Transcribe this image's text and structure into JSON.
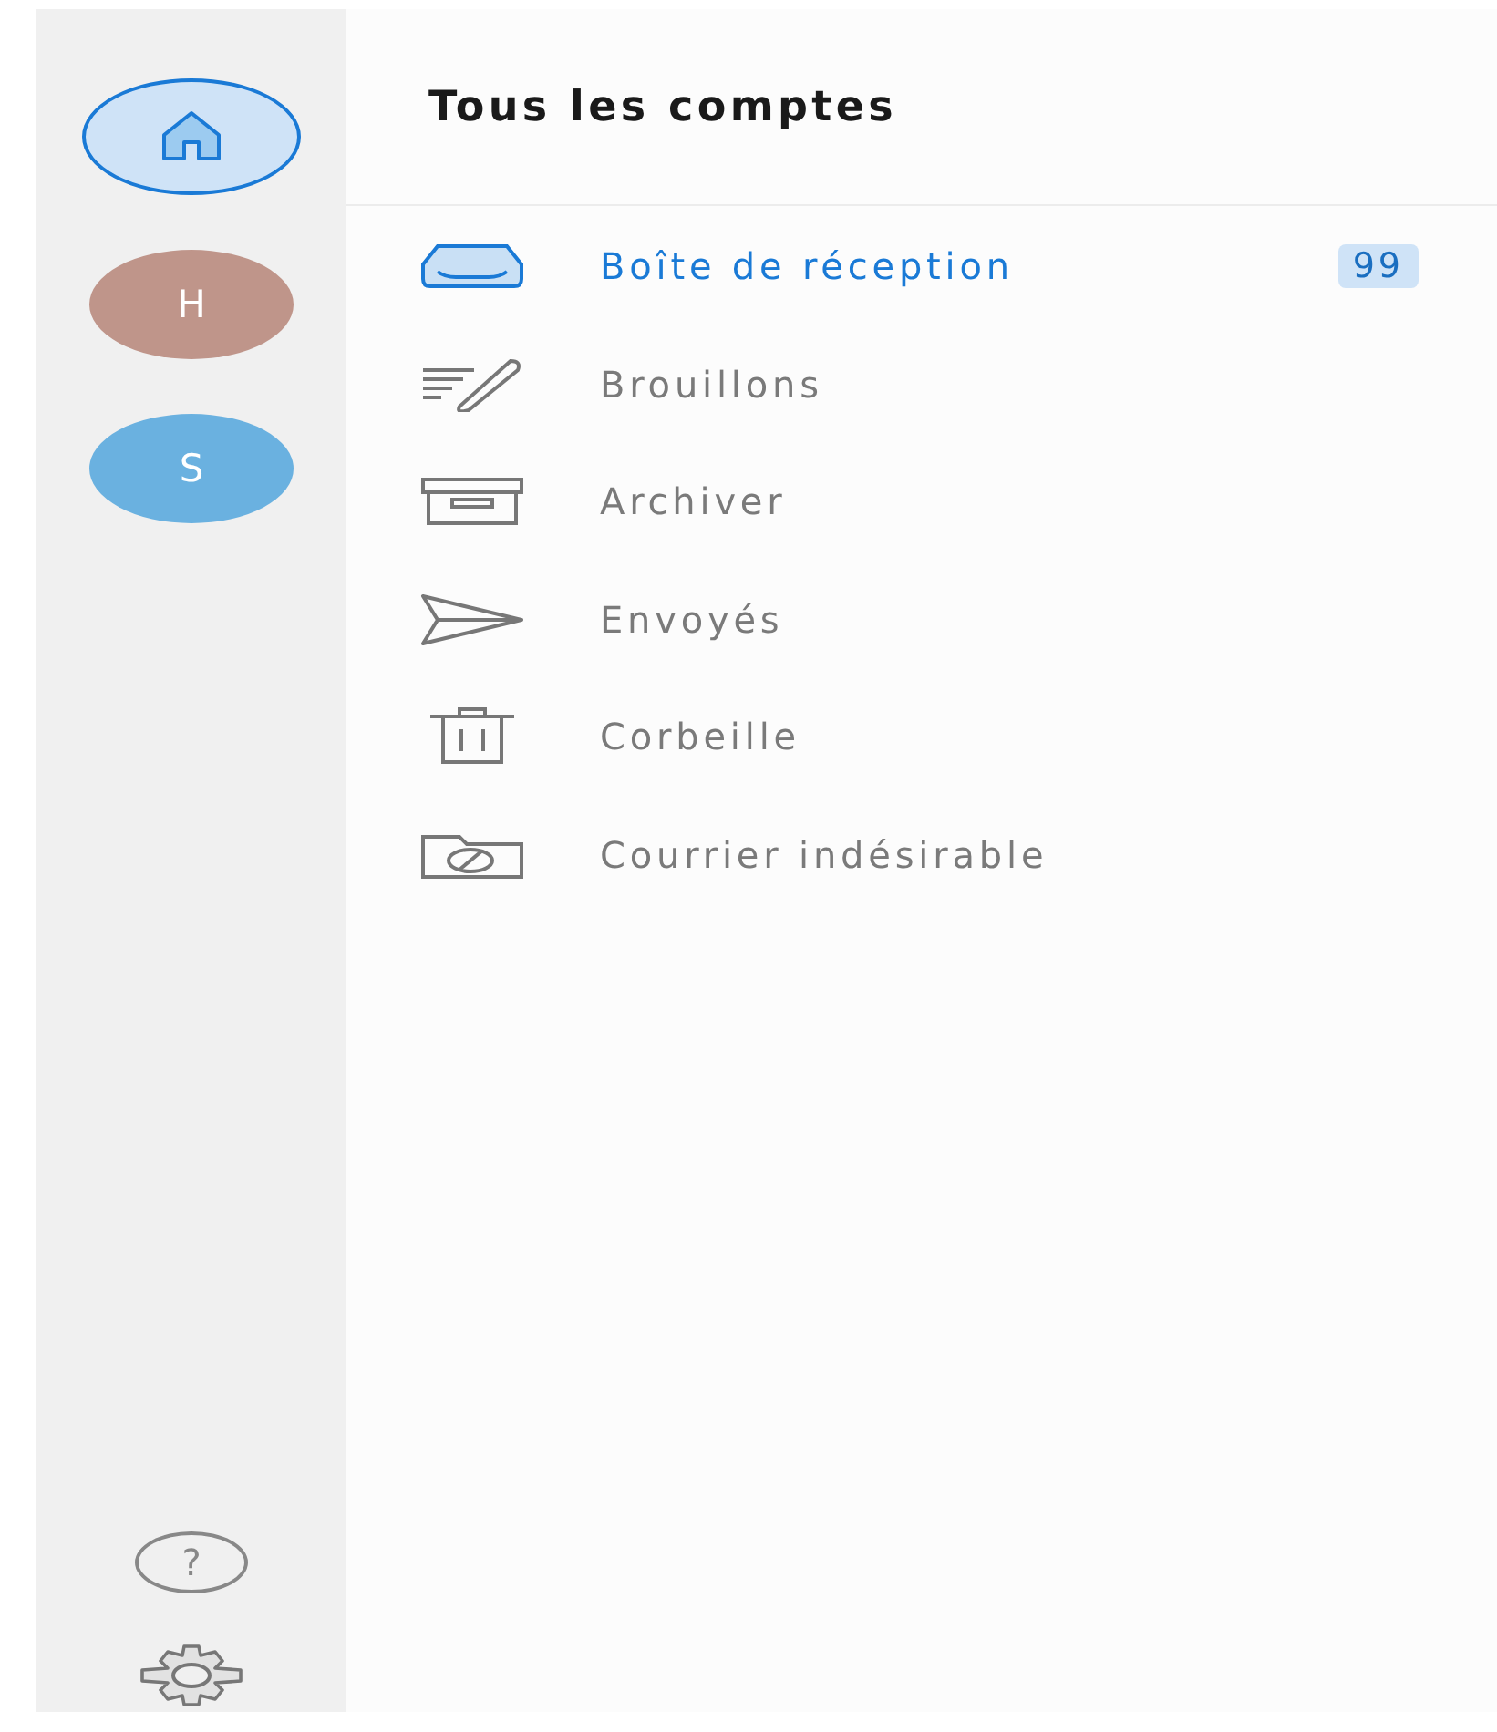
{
  "sidebar": {
    "accounts": [
      {
        "kind": "home",
        "selected": true
      },
      {
        "kind": "avatar",
        "label": "H",
        "color": "#bf958a",
        "selected": false
      },
      {
        "kind": "avatar",
        "label": "S",
        "color": "#6ab1e0",
        "selected": false
      }
    ],
    "help_button": "?"
  },
  "header": {
    "title": "Tous les comptes"
  },
  "folders": [
    {
      "kind": "inbox",
      "label": "Boîte de réception",
      "badge": "99",
      "selected": true
    },
    {
      "kind": "drafts",
      "label": "Brouillons",
      "selected": false
    },
    {
      "kind": "archive",
      "label": "Archiver",
      "selected": false
    },
    {
      "kind": "sent",
      "label": "Envoyés",
      "selected": false
    },
    {
      "kind": "trash",
      "label": "Corbeille",
      "selected": false
    },
    {
      "kind": "junk",
      "label": "Courrier indésirable",
      "selected": false
    }
  ]
}
